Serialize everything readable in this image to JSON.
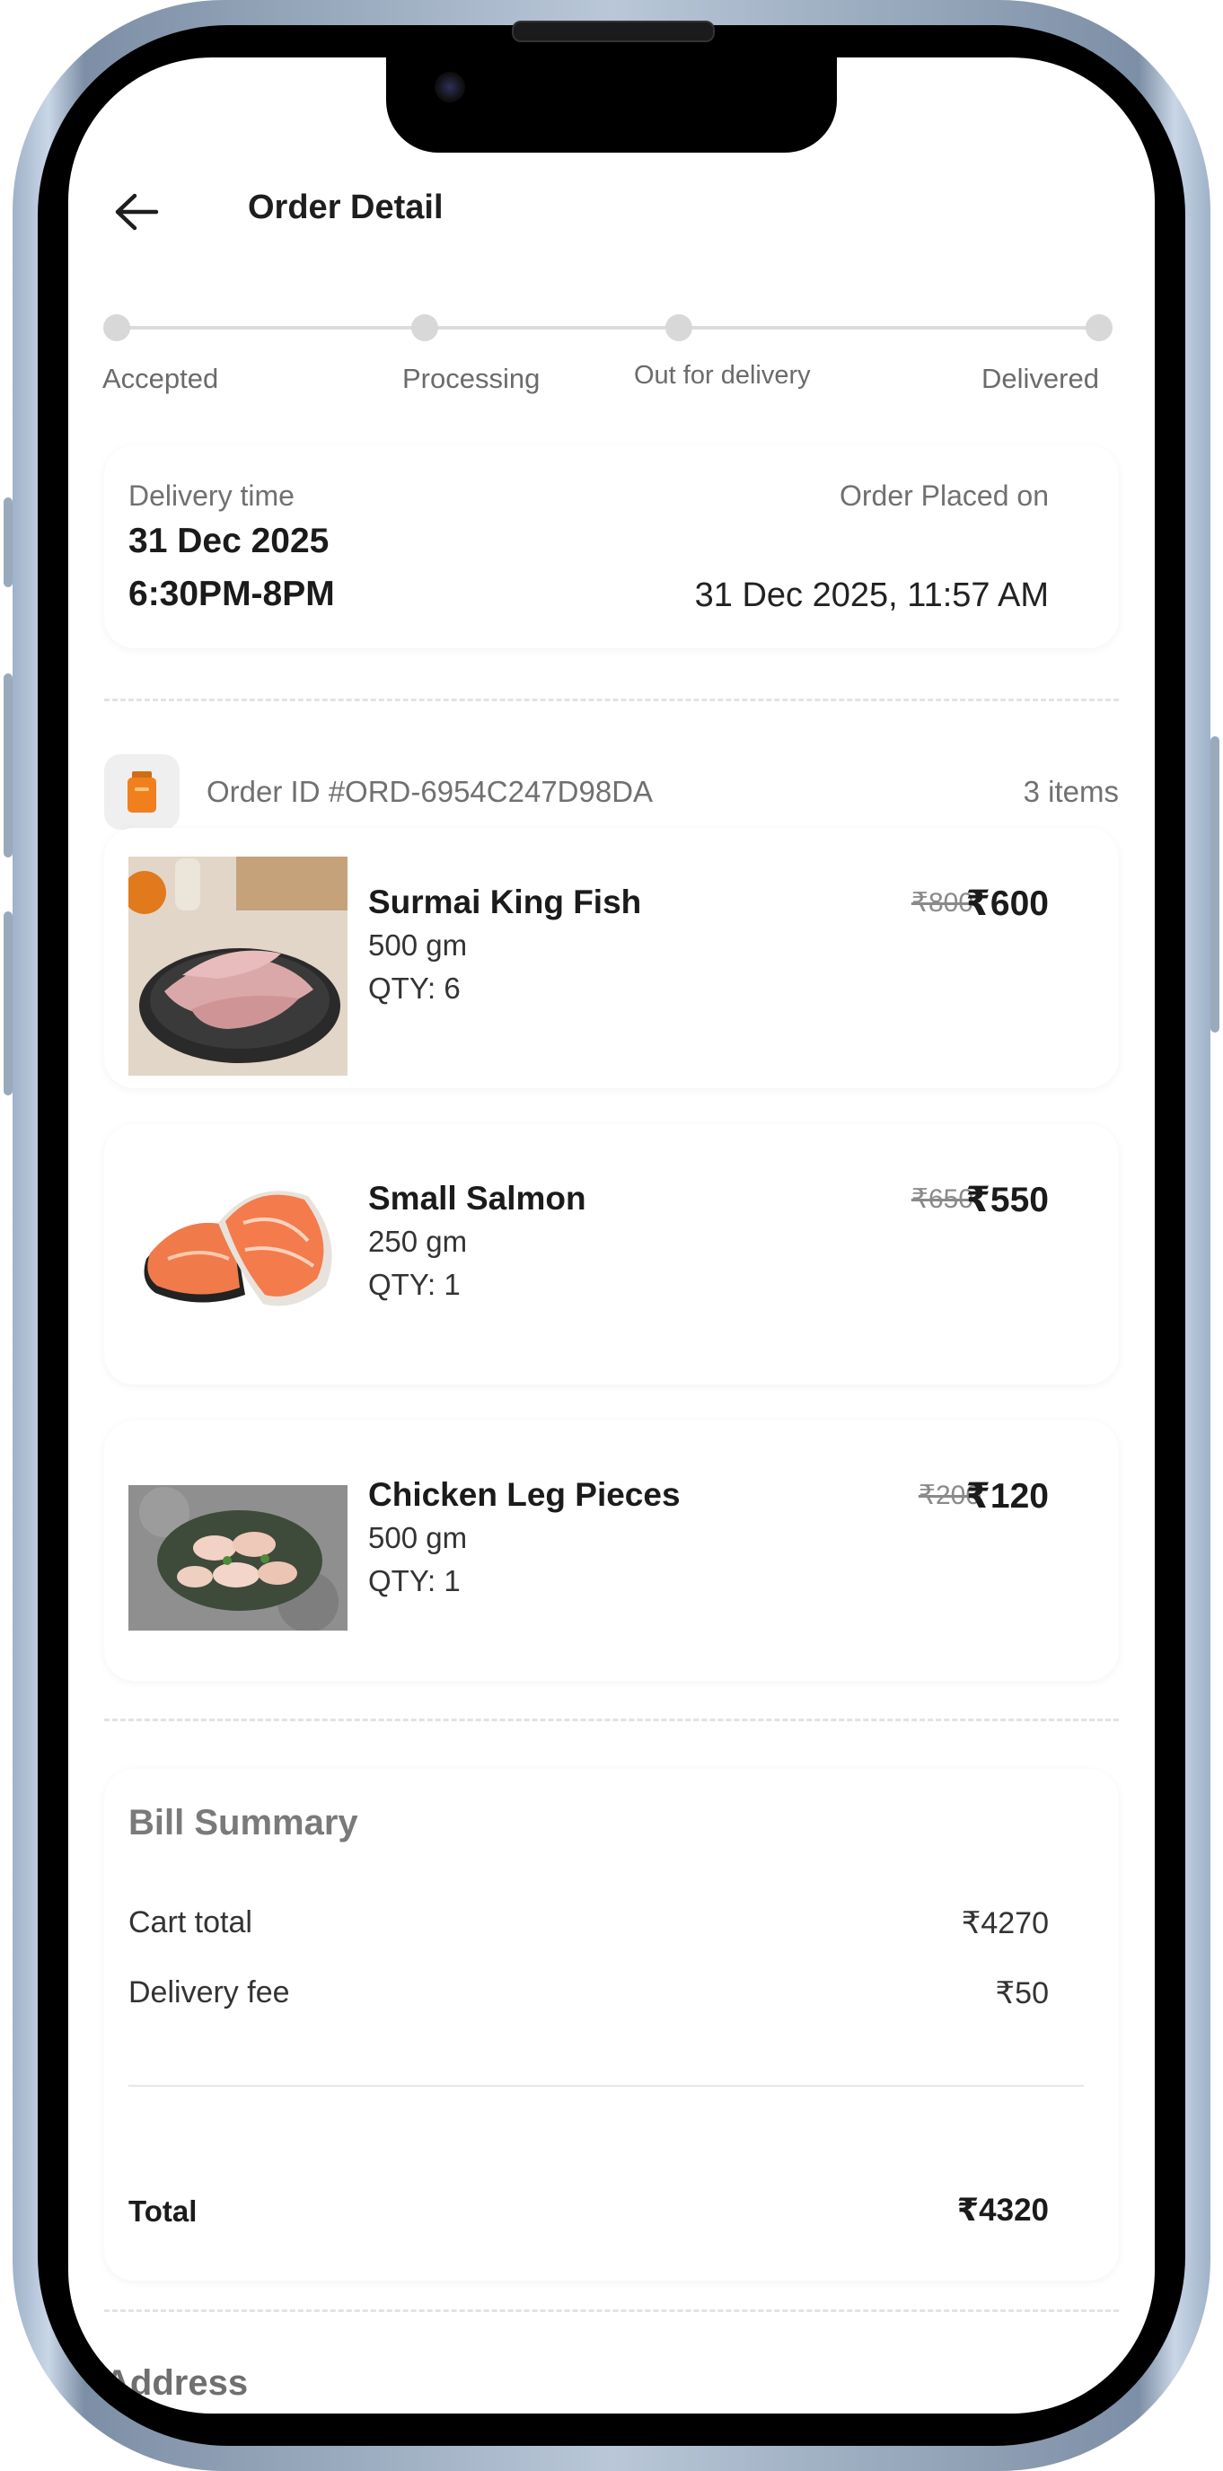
{
  "header": {
    "title": "Order Detail"
  },
  "progress": {
    "steps": [
      "Accepted",
      "Processing",
      "Out for delivery",
      "Delivered"
    ]
  },
  "delivery": {
    "time_label": "Delivery time",
    "date": "31 Dec 2025",
    "window": "6:30PM-8PM",
    "placed_label": "Order Placed on",
    "placed_on": "31 Dec 2025, 11:57 AM"
  },
  "order": {
    "id_text": "Order ID #ORD-6954C247D98DA",
    "items_count": "3 items"
  },
  "items": [
    {
      "name": "Surmai King Fish",
      "weight": "500 gm",
      "qty": "QTY: 6",
      "old_price": "₹800",
      "price": "₹600"
    },
    {
      "name": "Small Salmon",
      "weight": "250 gm",
      "qty": "QTY: 1",
      "old_price": "₹650",
      "price": "₹550"
    },
    {
      "name": "Chicken Leg Pieces",
      "weight": "500 gm",
      "qty": "QTY: 1",
      "old_price": "₹200",
      "price": "₹120"
    }
  ],
  "bill": {
    "title": "Bill Summary",
    "cart_total_label": "Cart total",
    "cart_total_value": "₹4270",
    "delivery_fee_label": "Delivery fee",
    "delivery_fee_value": "₹50",
    "total_label": "Total",
    "total_value": "₹4320"
  },
  "address": {
    "title": "Address"
  },
  "icons": {
    "back": "arrow-left-icon",
    "order": "package-icon"
  },
  "colors": {
    "accent": "#F0801E",
    "background": "#FFFFFF",
    "text": "#1B1B1B",
    "muted": "#707070"
  }
}
